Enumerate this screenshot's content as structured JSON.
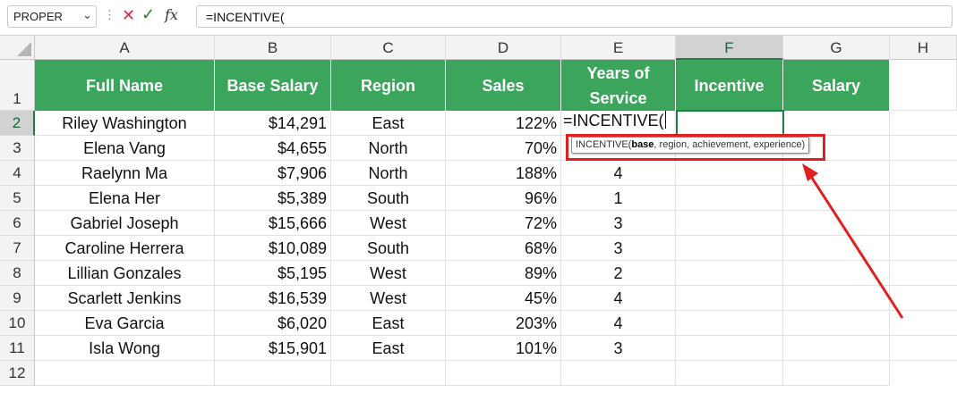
{
  "formula_bar": {
    "name_box": "PROPER",
    "name_box_dropdown": "chevron-down-icon",
    "dots": "⋮",
    "cancel_icon": "✕",
    "enter_icon": "✓",
    "fx_label": "fx",
    "formula": "=INCENTIVE("
  },
  "columns": [
    "A",
    "B",
    "C",
    "D",
    "E",
    "F",
    "G",
    "H"
  ],
  "active_column": "F",
  "rows": [
    "1",
    "2",
    "3",
    "4",
    "5",
    "6",
    "7",
    "8",
    "9",
    "10",
    "11",
    "12"
  ],
  "active_row": "2",
  "table": {
    "headers": [
      "Full Name",
      "Base Salary",
      "Region",
      "Sales",
      "Years of Service",
      "Incentive",
      "Salary"
    ],
    "header_color": "#3ba55c",
    "data": [
      [
        "Riley Washington",
        "$14,291",
        "East",
        "122%",
        ""
      ],
      [
        "Elena Vang",
        "$4,655",
        "North",
        "70%",
        ""
      ],
      [
        "Raelynn Ma",
        "$7,906",
        "North",
        "188%",
        "4"
      ],
      [
        "Elena Her",
        "$5,389",
        "South",
        "96%",
        "1"
      ],
      [
        "Gabriel Joseph",
        "$15,666",
        "West",
        "72%",
        "3"
      ],
      [
        "Caroline Herrera",
        "$10,089",
        "South",
        "68%",
        "3"
      ],
      [
        "Lillian Gonzales",
        "$5,195",
        "West",
        "89%",
        "2"
      ],
      [
        "Scarlett Jenkins",
        "$16,539",
        "West",
        "45%",
        "4"
      ],
      [
        "Eva Garcia",
        "$6,020",
        "East",
        "203%",
        "4"
      ],
      [
        "Isla Wong",
        "$15,901",
        "East",
        "101%",
        "3"
      ]
    ]
  },
  "editing_cell": {
    "address": "E2",
    "text": "=INCENTIVE("
  },
  "tooltip": {
    "fn": "INCENTIVE(",
    "current_arg": "base",
    "rest": ", region, achievement, experience)"
  },
  "annotation": {
    "highlight_color": "#e02020"
  }
}
